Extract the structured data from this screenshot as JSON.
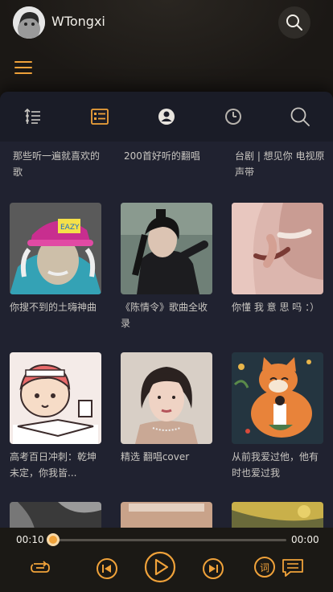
{
  "header": {
    "username": "WTongxi",
    "avatar_icon": "avatar-icon",
    "search_icon": "search-icon",
    "menu_icon": "hamburger-menu-icon"
  },
  "tabs": [
    {
      "icon": "sort-list-icon",
      "active": false
    },
    {
      "icon": "playlist-card-icon",
      "active": true
    },
    {
      "icon": "user-circle-icon",
      "active": false
    },
    {
      "icon": "clock-history-icon",
      "active": false
    },
    {
      "icon": "search-icon",
      "active": false
    }
  ],
  "top_row": [
    {
      "title": "那些听一遍就喜欢的歌"
    },
    {
      "title": "200首好听的翻唱"
    },
    {
      "title": "台剧 | 想见你 电视原声带"
    }
  ],
  "playlists": [
    {
      "title": "你搜不到的土嗨神曲",
      "cover": "einstein-cap-cover"
    },
    {
      "title": "《陈情令》歌曲全收录",
      "cover": "drama-actor-cover"
    },
    {
      "title": "你懂 我 意 思 吗 ：）",
      "cover": "smoking-hand-cover"
    },
    {
      "title": "高考百日冲刺：乾坤未定，你我皆...",
      "cover": "cartoon-study-cover"
    },
    {
      "title": "精选 翻唱cover",
      "cover": "girl-portrait-cover"
    },
    {
      "title": "从前我爱过他，他有时也爱过我",
      "cover": "orange-cat-cover"
    }
  ],
  "player": {
    "current_time": "00:10",
    "total_time": "00:00",
    "progress": 0.0,
    "lyrics_label": "词",
    "accent_color": "#f0a23a"
  }
}
